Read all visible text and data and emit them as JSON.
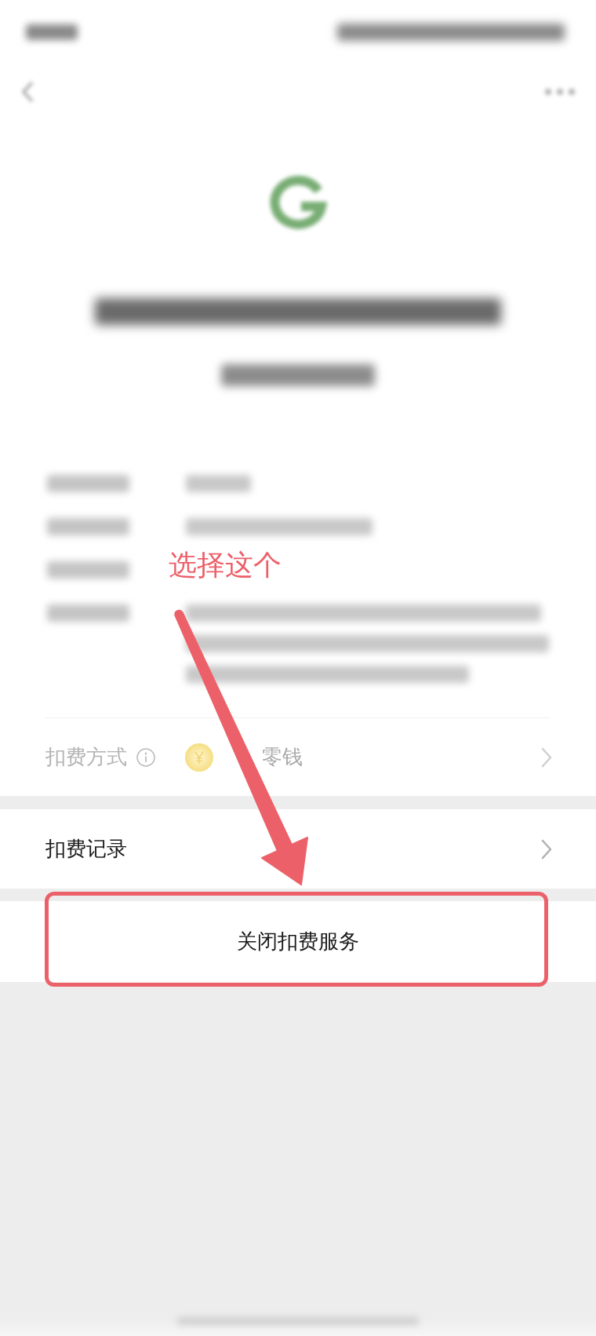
{
  "annotation": {
    "text": "选择这个",
    "arrow": true
  },
  "payment_method": {
    "label": "扣费方式",
    "value": "零钱",
    "faded": true
  },
  "menu_rows": [
    {
      "label": "扣费记录"
    }
  ],
  "close_button": {
    "label": "关闭扣费服务",
    "highlighted": true
  }
}
